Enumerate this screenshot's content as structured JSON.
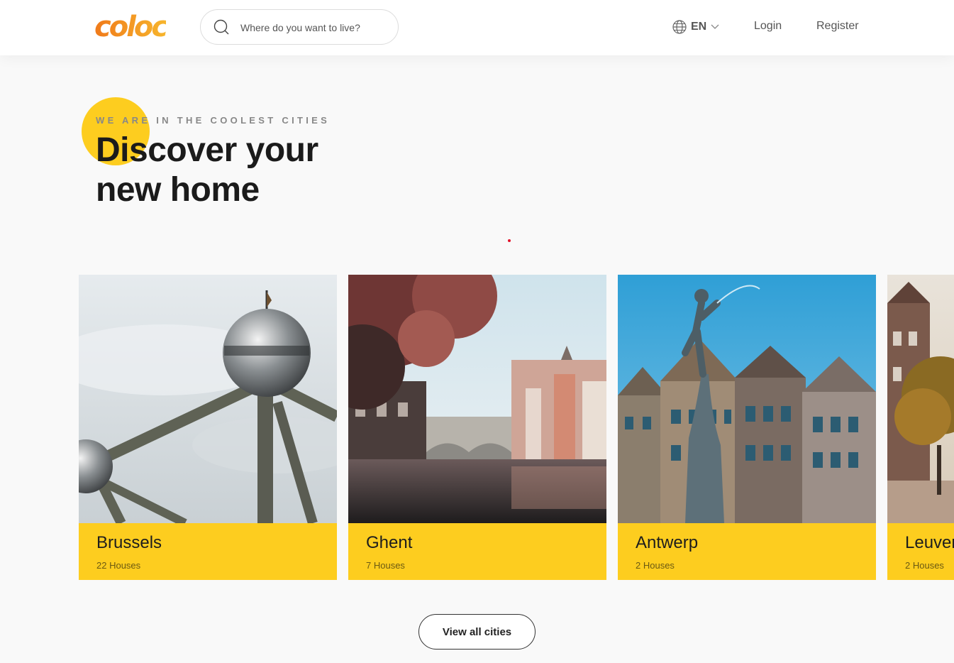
{
  "header": {
    "logo_text": "coloc",
    "search": {
      "placeholder": "Where do you want to live?"
    },
    "language": {
      "label": "EN",
      "icon": "globe-icon"
    },
    "login_label": "Login",
    "register_label": "Register"
  },
  "hero": {
    "eyebrow": "WE ARE IN THE COOLEST CITIES",
    "headline_line1": "Discover your",
    "headline_line2": "new home"
  },
  "cities": [
    {
      "name": "Brussels",
      "count": "22 Houses"
    },
    {
      "name": "Ghent",
      "count": "7 Houses"
    },
    {
      "name": "Antwerp",
      "count": "2 Houses"
    },
    {
      "name": "Leuven",
      "count": "2 Houses"
    }
  ],
  "view_all_label": "View all cities",
  "colors": {
    "accent": "#fdcd1f",
    "logo_start": "#f07a1a",
    "logo_end": "#f7b52c"
  }
}
